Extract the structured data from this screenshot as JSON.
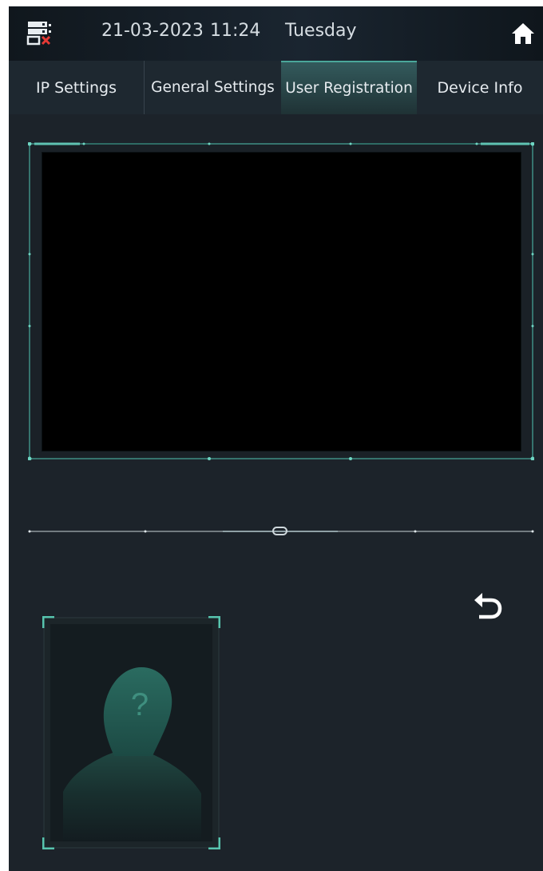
{
  "status_bar": {
    "date": "21-03-2023",
    "time": "11:24",
    "day": "Tuesday",
    "left_icon": "server-disconnected-icon",
    "right_icon": "home-icon"
  },
  "tabs": [
    {
      "label": "IP Settings",
      "active": false
    },
    {
      "label": "General Settings",
      "active": false
    },
    {
      "label": "User Registration",
      "active": true
    },
    {
      "label": "Device Info",
      "active": false
    }
  ],
  "user_photo": {
    "placeholder_mark": "?",
    "icon": "user-unknown-icon"
  },
  "controls": {
    "back_icon": "undo-icon"
  },
  "colors": {
    "background": "#1c232a",
    "accent": "#4aa79a",
    "active_tab": "#335a5c",
    "error": "#e53935"
  }
}
